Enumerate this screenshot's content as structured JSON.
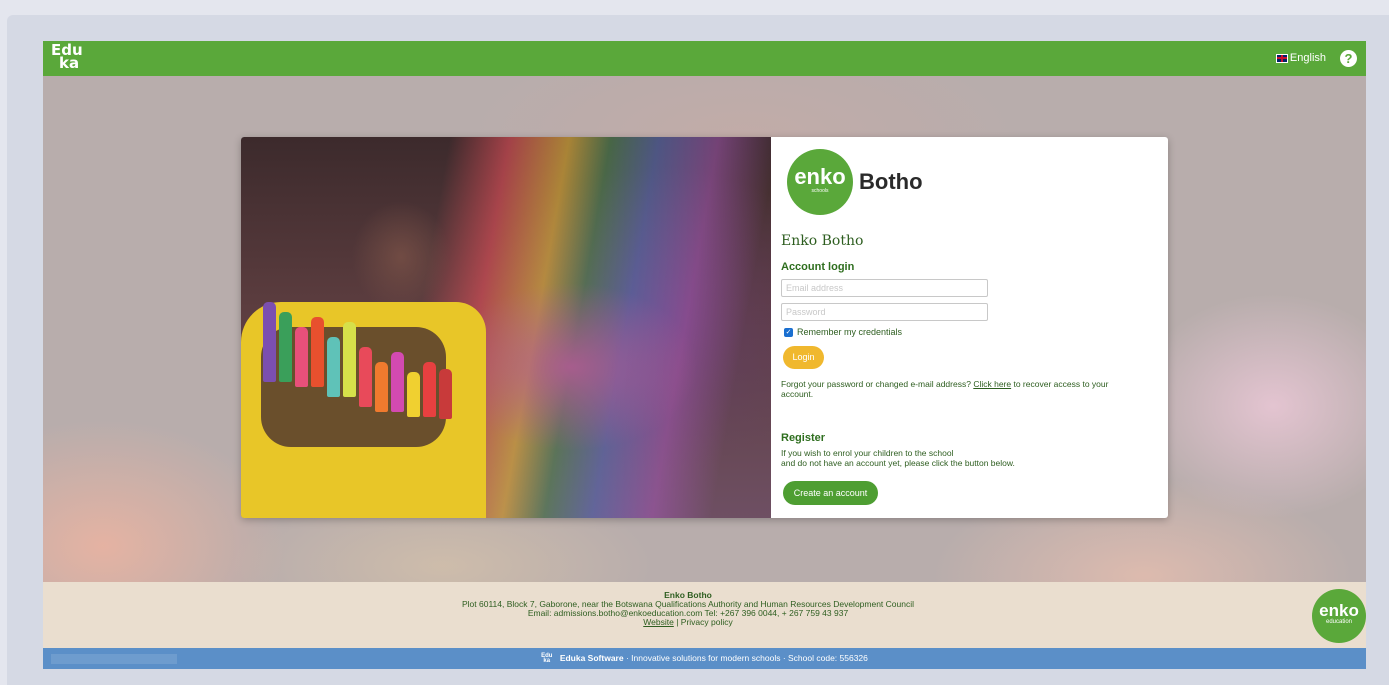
{
  "topbar": {
    "logo_line1": "Edu",
    "logo_line2": "ka",
    "language": "English",
    "help_icon": "?"
  },
  "brand": {
    "logo_main": "enko",
    "logo_sub": "schools",
    "name": "Botho"
  },
  "login": {
    "school_title": "Enko Botho",
    "section_title": "Account login",
    "email_placeholder": "Email address",
    "password_placeholder": "Password",
    "remember_label": "Remember my credentials",
    "login_button": "Login",
    "forgot_prefix": "Forgot your password or changed e-mail address?",
    "forgot_link": "Click here",
    "forgot_suffix": "to recover access to your account."
  },
  "register": {
    "title": "Register",
    "text_line1": "If you wish to enrol your children to the school",
    "text_line2": "and do not have an account yet, please click the button below.",
    "button": "Create an account"
  },
  "footer": {
    "school_name": "Enko Botho",
    "address": "Plot 60114, Block 7, Gaborone, near the Botswana Qualifications Authority and Human Resources Development Council",
    "contact": "Email: admissions.botho@enkoeducation.com Tel: +267 396 0044, + 267 759 43 937",
    "website_link": "Website",
    "separator": "|",
    "privacy_link": "Privacy policy",
    "logo_main": "enko",
    "logo_sub": "education"
  },
  "bottombar": {
    "mini_logo_1": "Edu",
    "mini_logo_2": "ka",
    "software_name": "Eduka Software",
    "tagline": "· Innovative solutions for modern schools · School code: 556326"
  },
  "colors": {
    "brand_green": "#5aa83a",
    "login_yellow": "#f0b82e",
    "bottom_blue": "#5b8fc8"
  }
}
